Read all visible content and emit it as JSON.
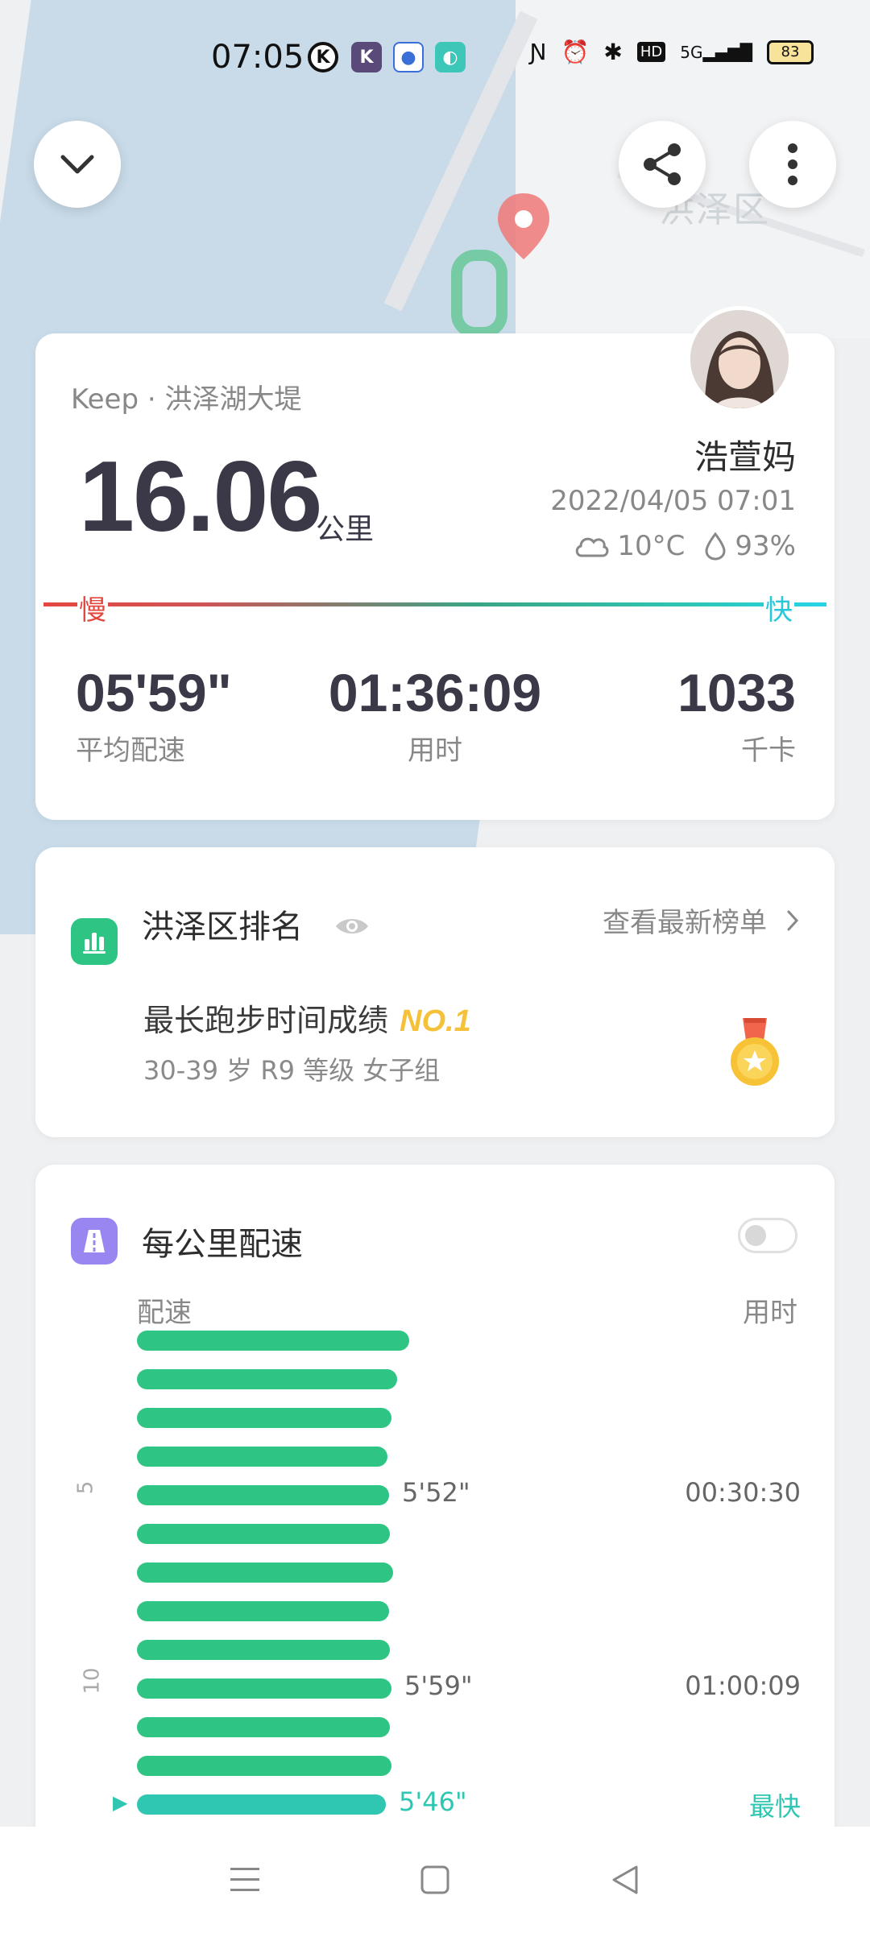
{
  "status_bar": {
    "time": "07:05",
    "apps": [
      "K-circle-icon",
      "keep-k-icon",
      "baidu-icon",
      "teal-app-icon"
    ],
    "right_icons": [
      "nfc-icon",
      "alarm-icon",
      "bluetooth-icon",
      "hd-icon",
      "5g-signal-icon"
    ],
    "hd": "HD",
    "network": "5G",
    "battery": "83"
  },
  "map": {
    "district": "洪泽区"
  },
  "summary": {
    "source": "Keep · 洪泽湖大堤",
    "distance": "16.06",
    "distance_unit": "公里",
    "username": "浩萱妈",
    "datetime": "2022/04/05 07:01",
    "temperature": "10°C",
    "humidity": "93%",
    "slow_label": "慢",
    "fast_label": "快",
    "stats": [
      {
        "value": "05'59\"",
        "label": "平均配速"
      },
      {
        "value": "01:36:09",
        "label": "用时"
      },
      {
        "value": "1033",
        "label": "千卡"
      }
    ]
  },
  "ranking": {
    "title": "洪泽区排名",
    "link": "查看最新榜单",
    "achievement": "最长跑步时间成绩",
    "rank": "NO.1",
    "group": "30-39 岁 R9 等级 女子组"
  },
  "splits": {
    "title": "每公里配速",
    "col_pace": "配速",
    "col_time": "用时",
    "km_labels": [
      "5",
      "10"
    ],
    "rows": [
      {
        "width_frac": 1.0
      },
      {
        "width_frac": 0.955
      },
      {
        "width_frac": 0.935
      },
      {
        "width_frac": 0.92
      },
      {
        "width_frac": 0.925,
        "pace": "5'52\"",
        "time": "00:30:30",
        "km": "5"
      },
      {
        "width_frac": 0.93
      },
      {
        "width_frac": 0.94
      },
      {
        "width_frac": 0.925
      },
      {
        "width_frac": 0.93
      },
      {
        "width_frac": 0.935,
        "pace": "5'59\"",
        "time": "01:00:09",
        "km": "10"
      },
      {
        "width_frac": 0.93
      },
      {
        "width_frac": 0.935
      },
      {
        "width_frac": 0.915,
        "pace": "5'46\"",
        "time": "最快",
        "fastest": true
      }
    ]
  },
  "colors": {
    "accent_green": "#2ec584",
    "fastest_teal": "#2fc6b2",
    "rank_gold": "#f5c13a",
    "slow_red": "#e3483f",
    "fast_cyan": "#27d4e6"
  }
}
